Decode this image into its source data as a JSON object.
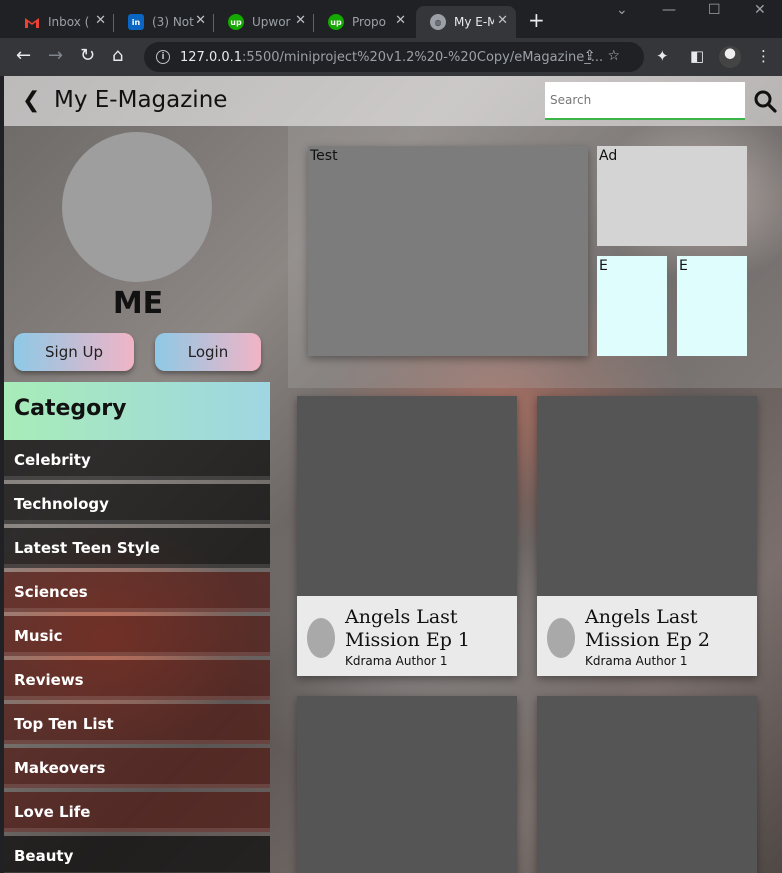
{
  "browser": {
    "tabs": [
      {
        "label": "Inbox (",
        "icon": "gmail-icon"
      },
      {
        "label": "(3) Not",
        "icon": "linkedin-icon"
      },
      {
        "label": "Upwor",
        "icon": "upwork-icon"
      },
      {
        "label": "Propo",
        "icon": "upwork-icon"
      },
      {
        "label": "My E-M",
        "icon": "globe-icon"
      }
    ],
    "url_host": "127.0.0.1",
    "url_path": ":5500/miniproject%20v1.2%20-%20Copy/eMagazine_..."
  },
  "header": {
    "title": "My E-Magazine",
    "search_placeholder": "Search"
  },
  "sidebar": {
    "profile_name": "ME",
    "signup_label": "Sign Up",
    "login_label": "Login",
    "category_heading": "Category",
    "categories": [
      "Celebrity",
      "Technology",
      "Latest Teen Style",
      "Sciences",
      "Music",
      "Reviews",
      "Top Ten List",
      "Makeovers",
      "Love Life",
      "Beauty"
    ]
  },
  "main": {
    "feature_label": "Test",
    "ad_label": "Ad",
    "small_labels": [
      "E",
      "E"
    ],
    "articles": [
      {
        "title": "Angels Last Mission Ep 1",
        "author": "Kdrama Author 1"
      },
      {
        "title": "Angels Last Mission Ep 2",
        "author": "Kdrama Author 1"
      }
    ]
  },
  "colors": {
    "accent_green": "#3bb54a",
    "button_gradient_start": "#8ec9e6",
    "button_gradient_end": "#f1b4c6",
    "category_gradient_start": "#a8ecb8",
    "category_gradient_end": "#9fd6e2"
  }
}
